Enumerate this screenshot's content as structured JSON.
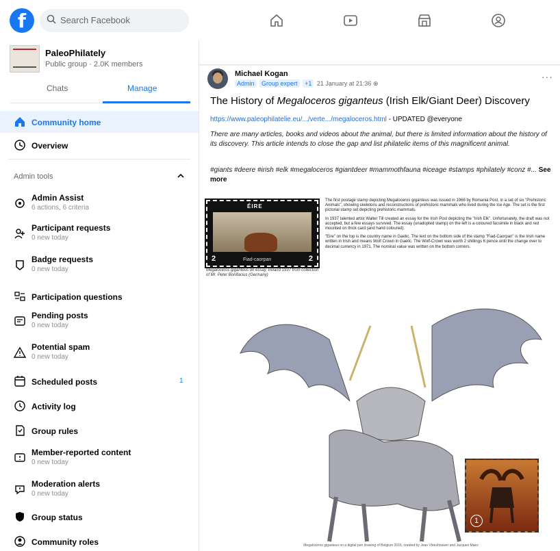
{
  "topbar": {
    "search_placeholder": "Search Facebook",
    "nav_icons": [
      "home-icon",
      "video-icon",
      "marketplace-icon",
      "groups-icon"
    ]
  },
  "group": {
    "name": "PaleoPhilately",
    "subtitle": "Public group · 2.0K members"
  },
  "tabs": [
    {
      "label": "Chats"
    },
    {
      "label": "Manage"
    }
  ],
  "menu": {
    "community_home": "Community home",
    "overview": "Overview",
    "admin_tools_label": "Admin tools",
    "items": [
      {
        "label": "Admin Assist",
        "sub": "6 actions, 6 criteria",
        "icon": "admin-assist-icon"
      },
      {
        "label": "Participant requests",
        "sub": "0 new today",
        "icon": "participant-requests-icon"
      },
      {
        "label": "Badge requests",
        "sub": "0 new today",
        "icon": "badge-icon"
      },
      {
        "label": "Participation questions",
        "sub": "",
        "icon": "questions-icon"
      },
      {
        "label": "Pending posts",
        "sub": "0 new today",
        "icon": "pending-posts-icon"
      },
      {
        "label": "Potential spam",
        "sub": "0 new today",
        "icon": "warning-icon"
      },
      {
        "label": "Scheduled posts",
        "sub": "",
        "icon": "calendar-icon",
        "count": "1"
      },
      {
        "label": "Activity log",
        "sub": "",
        "icon": "clock-icon"
      },
      {
        "label": "Group rules",
        "sub": "",
        "icon": "rules-icon"
      },
      {
        "label": "Member-reported content",
        "sub": "0 new today",
        "icon": "report-icon"
      },
      {
        "label": "Moderation alerts",
        "sub": "0 new today",
        "icon": "alert-icon"
      },
      {
        "label": "Group status",
        "sub": "",
        "icon": "shield-icon"
      },
      {
        "label": "Community roles",
        "sub": "",
        "icon": "roles-icon"
      }
    ]
  },
  "post": {
    "author": "Michael Kogan",
    "badges": [
      "Admin",
      "Group expert",
      "+1"
    ],
    "time": "21 January at 21:36",
    "title_prefix": "The History of ",
    "title_italic": "Megaloceros giganteus",
    "title_suffix": " (Irish Elk/Giant Deer) Discovery",
    "link": "https://www.paleophilatelie.eu/.../verte.../megaloceros.html",
    "link_suffix": " - UPDATED @everyone",
    "description": "There are many articles, books and videos about the animal, but there is limited information about the history of its discovery. This article intends to close the gap and list philatelic items of this magnificent animal.",
    "hashtags": "#giants #deere #irish #elk #megaloceros #giantdeer #mammothfauna #iceage #stamps #philately #conz #...",
    "see_more": "See more"
  },
  "document": {
    "stamp_country": "ÉIRE",
    "stamp_value": "2",
    "stamp_caption_text": "Fiad-caorpan",
    "stamp_caption": "Megaloceros giganteus on essay, Ireland 1937 from collection of Mr. Peter Bonifacius (Germany)",
    "paragraphs": [
      "The first postage stamp depicting Megaloceros giganteus was issued in 1966 by Romania Post, in a set of six \"Prehistoric Animals\", showing skeletons and reconstructions of prehistoric mammals who lived during the Ice Age. The set is the first pictorial stamp set depicting prehistoric mammals.",
      "In 1937 talented artist Walter Till created an essay for the Irish Post depicting the \"Irish Elk\". Unfortunately, the draft was not accepted, but a few essays survived. The essay (unadopted stamp) on the left is a coloured facsimile in black and red mounted on thick card (and hand coloured).",
      "\"Eire\" on the top is the country name in Gaelic. The text on the bottom side of the stamp \"Fiad-Caorpan\" is the Irish name written in Irish and means Wolf Crown in Gaelic. The Wolf-Crown was worth 2 shillings 6 pence until the change over to decimal currency in 1971. The nominal value was written on the bottom corners."
    ],
    "stamp2_value": "1",
    "drawing_caption": "Megaloceros giganteus on a digital pen drawing of Belgium 2016, created by Jean Vleeshouwer and Jacques Maes"
  }
}
